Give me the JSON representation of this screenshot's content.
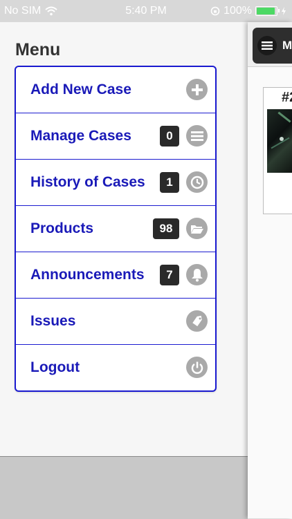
{
  "status_bar": {
    "carrier": "No SIM",
    "time": "5:40 PM",
    "battery": "100%"
  },
  "menu": {
    "title": "Menu",
    "items": [
      {
        "label": "Add New Case",
        "icon": "plus-icon"
      },
      {
        "label": "Manage Cases",
        "badge": "0",
        "icon": "list-icon"
      },
      {
        "label": "History of Cases",
        "badge": "1",
        "icon": "clock-icon"
      },
      {
        "label": "Products",
        "badge": "98",
        "icon": "folder-icon"
      },
      {
        "label": "Announcements",
        "badge": "7",
        "icon": "bell-icon"
      },
      {
        "label": "Issues",
        "icon": "tag-icon"
      },
      {
        "label": "Logout",
        "icon": "power-icon"
      }
    ]
  },
  "content": {
    "toggle_label": "M",
    "case_number": "#2"
  },
  "colors": {
    "accent": "#1a1ab8",
    "border": "#1a1ad0",
    "battery": "#4cd964"
  }
}
